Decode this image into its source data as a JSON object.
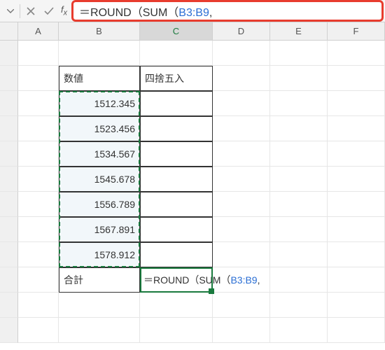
{
  "formula_bar": {
    "formula_prefix": "＝ROUND（SUM（",
    "formula_ref": "B3:B9",
    "formula_suffix": ","
  },
  "columns": {
    "A": "A",
    "B": "B",
    "C": "C",
    "D": "D",
    "E": "E",
    "F": "F"
  },
  "headers": {
    "b2": "数値",
    "c2": "四捨五入",
    "b10": "合計"
  },
  "data": {
    "b3": "1512.345",
    "b4": "1523.456",
    "b5": "1534.567",
    "b6": "1545.678",
    "b7": "1556.789",
    "b8": "1567.891",
    "b9": "1578.912"
  },
  "editing": {
    "prefix": "＝ROUND（SUM（",
    "ref": "B3:B9",
    "suffix": ","
  },
  "chart_data": {
    "type": "table",
    "columns": [
      "数値",
      "四捨五入"
    ],
    "rows": [
      [
        1512.345,
        null
      ],
      [
        1523.456,
        null
      ],
      [
        1534.567,
        null
      ],
      [
        1545.678,
        null
      ],
      [
        1556.789,
        null
      ],
      [
        1567.891,
        null
      ],
      [
        1578.912,
        null
      ]
    ],
    "footer_label": "合計",
    "active_formula": "=ROUND(SUM(B3:B9,"
  }
}
